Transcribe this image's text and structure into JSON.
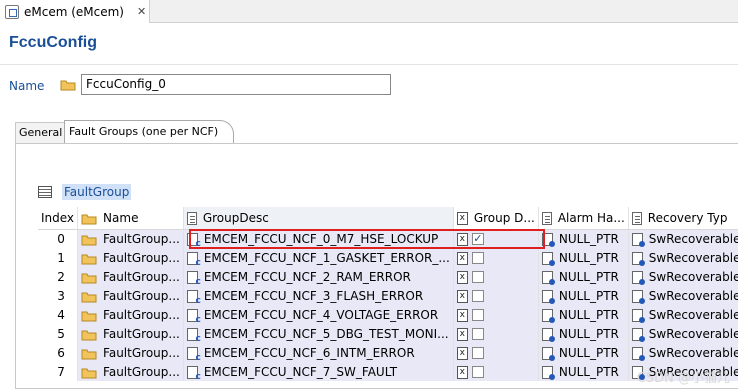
{
  "editor_tab": {
    "label": "eMcem (eMcem)",
    "close": "✕"
  },
  "page_title": "FccuConfig",
  "name_field": {
    "label": "Name",
    "value": "FccuConfig_0"
  },
  "sub_tabs": [
    "General",
    "Fault Groups (one per NCF)"
  ],
  "section": "FaultGroup",
  "columns": [
    "Index",
    "Name",
    "GroupDesc",
    "Group D...",
    "Alarm Ha...",
    "Recovery Typ"
  ],
  "rows": [
    {
      "index": "0",
      "name": "FaultGroup...",
      "desc": "EMCEM_FCCU_NCF_0_M7_HSE_LOCKUP",
      "checked": true,
      "alarm": "NULL_PTR",
      "recovery": "SwRecoverable"
    },
    {
      "index": "1",
      "name": "FaultGroup...",
      "desc": "EMCEM_FCCU_NCF_1_GASKET_ERROR_...",
      "checked": false,
      "alarm": "NULL_PTR",
      "recovery": "SwRecoverable"
    },
    {
      "index": "2",
      "name": "FaultGroup...",
      "desc": "EMCEM_FCCU_NCF_2_RAM_ERROR",
      "checked": false,
      "alarm": "NULL_PTR",
      "recovery": "SwRecoverable"
    },
    {
      "index": "3",
      "name": "FaultGroup...",
      "desc": "EMCEM_FCCU_NCF_3_FLASH_ERROR",
      "checked": false,
      "alarm": "NULL_PTR",
      "recovery": "SwRecoverable"
    },
    {
      "index": "4",
      "name": "FaultGroup...",
      "desc": "EMCEM_FCCU_NCF_4_VOLTAGE_ERROR",
      "checked": false,
      "alarm": "NULL_PTR",
      "recovery": "SwRecoverable"
    },
    {
      "index": "5",
      "name": "FaultGroup...",
      "desc": "EMCEM_FCCU_NCF_5_DBG_TEST_MONI...",
      "checked": false,
      "alarm": "NULL_PTR",
      "recovery": "SwRecoverable"
    },
    {
      "index": "6",
      "name": "FaultGroup...",
      "desc": "EMCEM_FCCU_NCF_6_INTM_ERROR",
      "checked": false,
      "alarm": "NULL_PTR",
      "recovery": "SwRecoverable"
    },
    {
      "index": "7",
      "name": "FaultGroup...",
      "desc": "EMCEM_FCCU_NCF_7_SW_FAULT",
      "checked": false,
      "alarm": "NULL_PTR",
      "recovery": "SwRecoverable"
    }
  ],
  "watermark": "CSDN @小猫儿",
  "colors": {
    "title": "#1a4f96",
    "highlight": "#e02020",
    "row_bg": "#e8e8f6"
  }
}
